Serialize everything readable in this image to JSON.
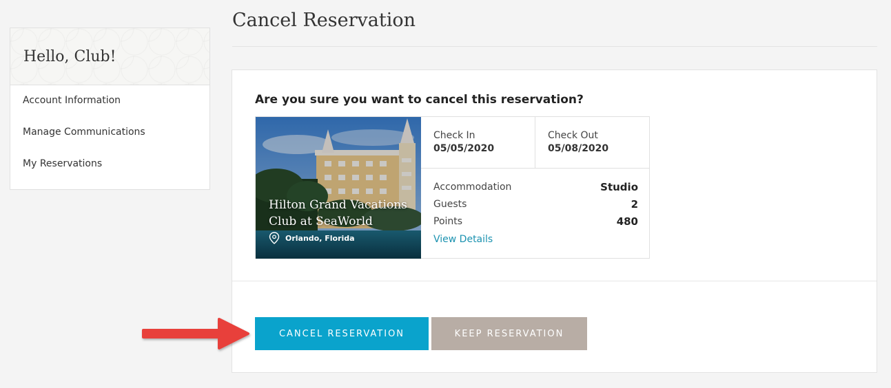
{
  "sidebar": {
    "greeting": "Hello, Club!",
    "items": [
      {
        "label": "Account Information"
      },
      {
        "label": "Manage Communications"
      },
      {
        "label": "My Reservations"
      }
    ]
  },
  "page": {
    "title": "Cancel Reservation"
  },
  "cancel_card": {
    "question": "Are you sure you want to cancel this reservation?",
    "hotel": {
      "name": "Hilton Grand Vacations Club at SeaWorld",
      "location": "Orlando, Florida"
    },
    "check_in": {
      "label": "Check In",
      "value": "05/05/2020"
    },
    "check_out": {
      "label": "Check Out",
      "value": "05/08/2020"
    },
    "details": [
      {
        "label": "Accommodation",
        "value": "Studio"
      },
      {
        "label": "Guests",
        "value": "2"
      },
      {
        "label": "Points",
        "value": "480"
      }
    ],
    "view_details_label": "View Details",
    "cancel_button_label": "CANCEL RESERVATION",
    "keep_button_label": "KEEP RESERVATION"
  },
  "colors": {
    "accent": "#0aa3cc",
    "secondary_button": "#b8ada5",
    "link": "#1b92b0",
    "arrow": "#e8413a"
  },
  "icons": {
    "location": "map-pin-icon",
    "pointer": "red-arrow-annotation"
  }
}
